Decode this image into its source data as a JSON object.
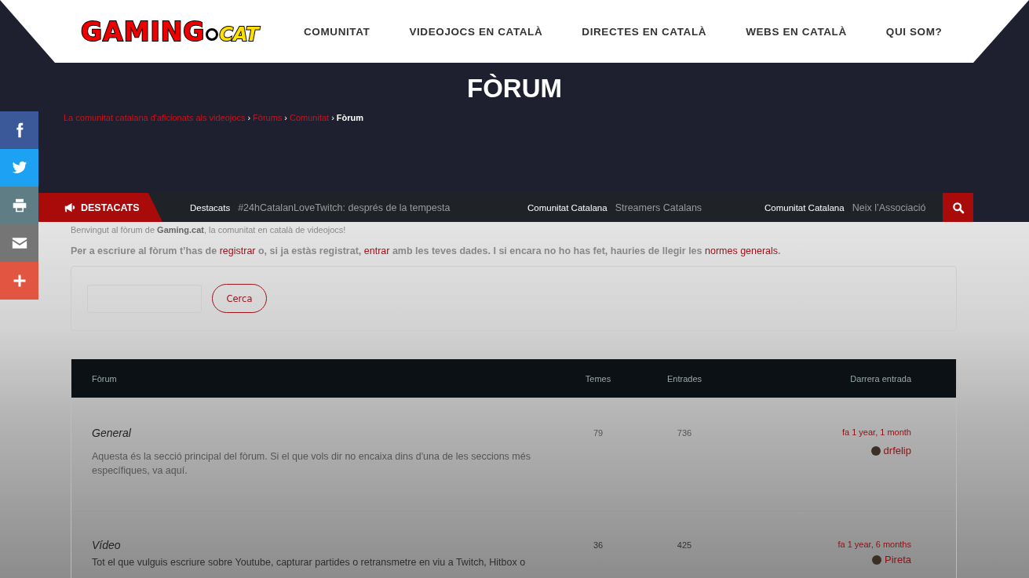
{
  "logo": {
    "main": "GAMING",
    "suffix": "CAT"
  },
  "nav": [
    "COMUNITAT",
    "VIDEOJOCS EN CATALÀ",
    "DIRECTES EN CATALÀ",
    "WEBS EN CATALÀ",
    "QUI SOM?"
  ],
  "page_title": "FÒRUM",
  "breadcrumb_separator": "›",
  "breadcrumb": [
    {
      "label": "La comunitat catalana d'aficionats als videojocs",
      "current": false
    },
    {
      "label": "Fòrums",
      "current": false
    },
    {
      "label": "Comunitat",
      "current": false
    },
    {
      "label": "Fòrum",
      "current": true
    }
  ],
  "social": [
    {
      "kind": "facebook",
      "color": "#3b5998"
    },
    {
      "kind": "twitter",
      "color": "#1da1f2"
    },
    {
      "kind": "print",
      "color": "#5f7d84"
    },
    {
      "kind": "email",
      "color": "#757575"
    },
    {
      "kind": "more",
      "color": "#e25541"
    }
  ],
  "ticker": {
    "label": "DESTACATS",
    "items": [
      {
        "category": "Destacats",
        "title": "#24hCatalanLoveTwitch: després de la tempesta"
      },
      {
        "category": "Comunitat Catalana",
        "title": "Streamers Catalans"
      },
      {
        "category": "Comunitat Catalana",
        "title": "Neix l’Associació"
      }
    ]
  },
  "welcome": "Benvingut al fòrum de **Gaming.cat**, la comunitat en català de videojocs!",
  "notice": [
    {
      "text": "Per a escriure al fòrum t’has de ",
      "link": false
    },
    {
      "text": "registrar",
      "link": true
    },
    {
      "text": " o, si ja estàs registrat, ",
      "link": false
    },
    {
      "text": "entrar",
      "link": true
    },
    {
      "text": " amb les teves dades. I si encara no ho has fet, hauries de llegir les ",
      "link": false
    },
    {
      "text": "normes generals",
      "link": true
    },
    {
      "text": ".",
      "link": false
    }
  ],
  "search": {
    "button": "Cerca"
  },
  "table": {
    "columns": [
      "Fòrum",
      "Temes",
      "Entrades",
      "Darrera entrada"
    ],
    "rows": [
      {
        "name": "General",
        "description": "Aquesta és la secció principal del fòrum. Si el que vols dir no encaixa dins d'una de les seccions més específiques, va aquí.",
        "topics": "79",
        "posts": "736",
        "last_time": "fa 1 year, 1 month",
        "last_user": "drfelip"
      },
      {
        "name": "Vídeo",
        "description": "Tot el que vulguis escriure sobre Youtube, capturar partides o retransmetre en viu a Twitch, Hitbox o",
        "topics": "36",
        "posts": "425",
        "last_time": "fa 1 year, 6 months",
        "last_user": "Pireta"
      }
    ]
  }
}
